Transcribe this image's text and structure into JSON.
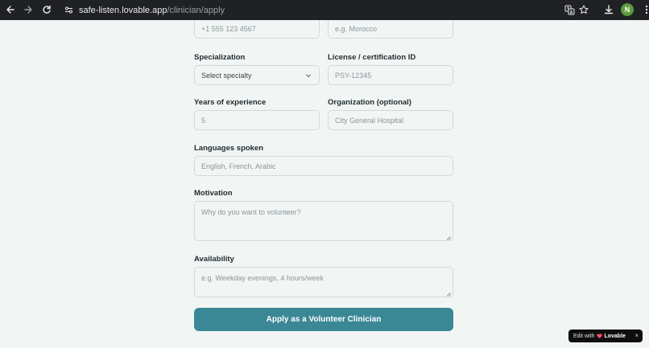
{
  "browser": {
    "url_host": "safe-listen.lovable.app",
    "url_path": "/clinician/apply",
    "avatar_initial": "N"
  },
  "form": {
    "phone": {
      "placeholder": "+1 555 123 4567"
    },
    "country": {
      "placeholder": "e.g. Morocco"
    },
    "specialization": {
      "label": "Specialization",
      "selected": "Select specialty"
    },
    "license": {
      "label": "License / certification ID",
      "placeholder": "PSY-12345"
    },
    "experience": {
      "label": "Years of experience",
      "placeholder": "5"
    },
    "organization": {
      "label": "Organization (optional)",
      "placeholder": "City General Hospital"
    },
    "languages": {
      "label": "Languages spoken",
      "placeholder": "English, French, Arabic"
    },
    "motivation": {
      "label": "Motivation",
      "placeholder": "Why do you want to volunteer?"
    },
    "availability": {
      "label": "Availability",
      "placeholder": "e.g. Weekday evenings, 4 hours/week"
    },
    "submit_label": "Apply as a Volunteer Clinician"
  },
  "badge": {
    "prefix": "Edit with",
    "brand": "Lovable",
    "close": "×"
  },
  "colors": {
    "accent": "#3a8796",
    "background": "#f1f6f5",
    "chrome": "#202124"
  }
}
